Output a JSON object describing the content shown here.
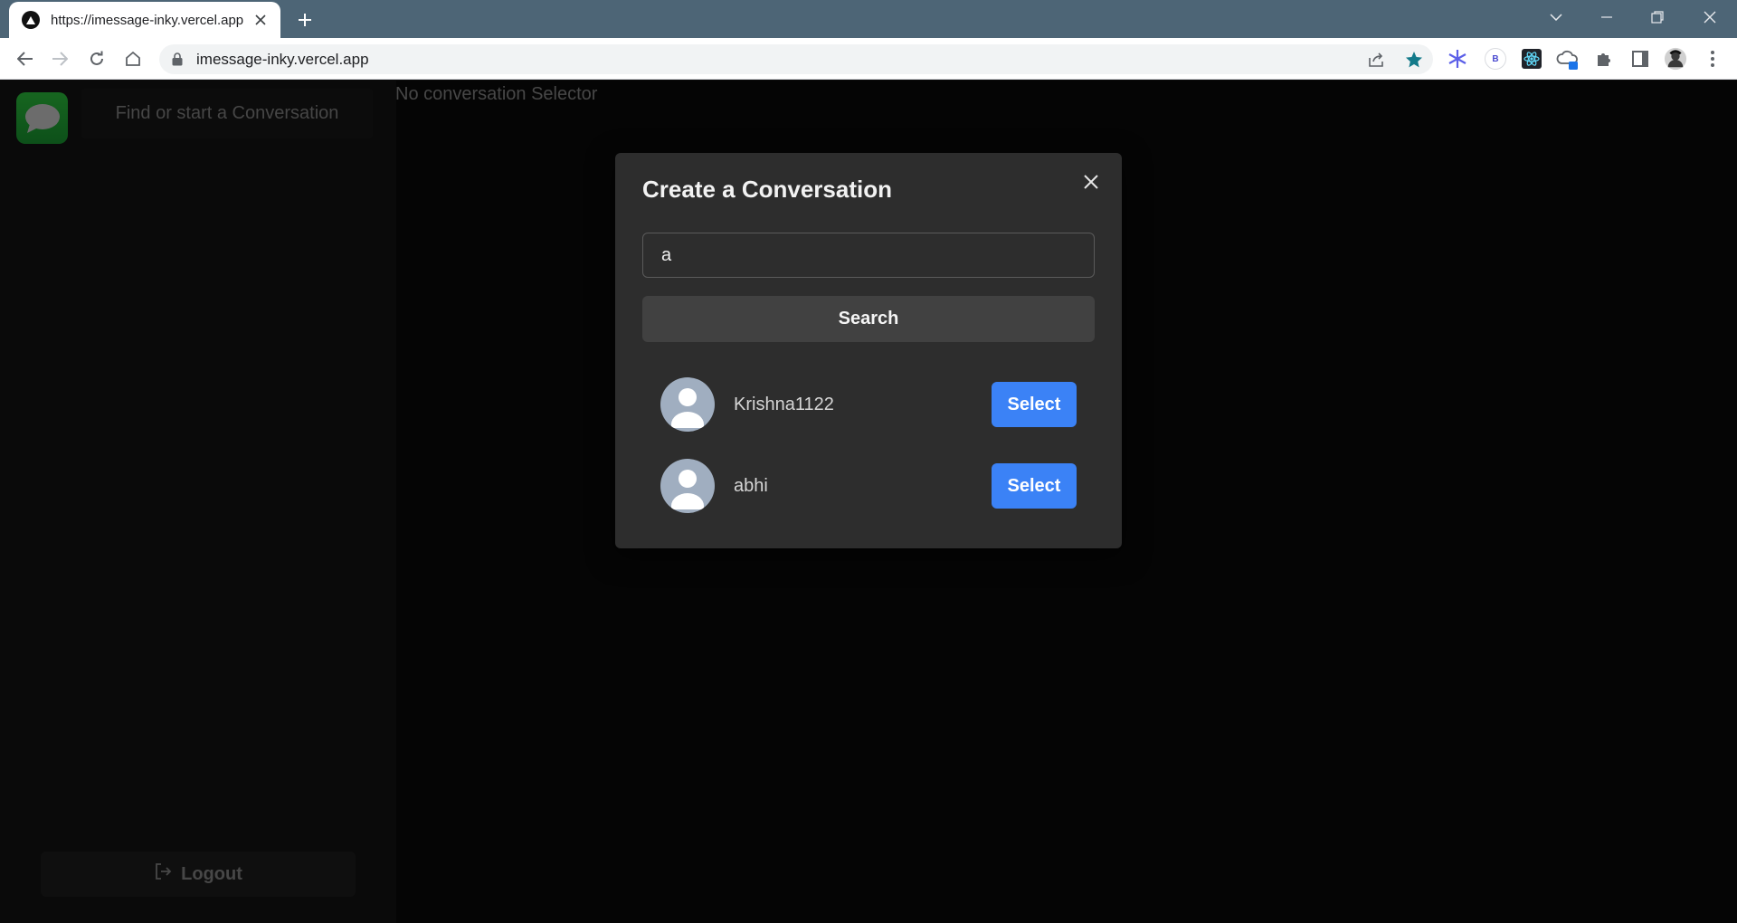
{
  "browser": {
    "tab_title": "https://imessage-inky.vercel.app",
    "url": "imessage-inky.vercel.app",
    "extension_badge_b": "B"
  },
  "sidebar": {
    "find_placeholder": "Find or start a Conversation",
    "logout_label": "Logout"
  },
  "main": {
    "empty_text": "No conversation Selector"
  },
  "modal": {
    "title": "Create a Conversation",
    "search_value": "a",
    "search_button": "Search",
    "users": [
      {
        "username": "Krishna1122",
        "select_label": "Select"
      },
      {
        "username": "abhi",
        "select_label": "Select"
      }
    ]
  },
  "colors": {
    "accent_blue": "#3b82f6",
    "app_green": "#2ecc40",
    "tabbar": "#4d6576",
    "modal_bg": "#2d2d2d"
  },
  "icons": [
    "vercel-icon",
    "close-icon",
    "plus-icon",
    "chevron-down-icon",
    "minimize-icon",
    "restore-icon",
    "back-icon",
    "forward-icon",
    "reload-icon",
    "home-icon",
    "lock-icon",
    "share-icon",
    "star-icon",
    "puzzle-icon",
    "sidepanel-icon",
    "profile-icon",
    "menu-icon",
    "message-bubble-icon",
    "logout-icon",
    "user-icon"
  ]
}
